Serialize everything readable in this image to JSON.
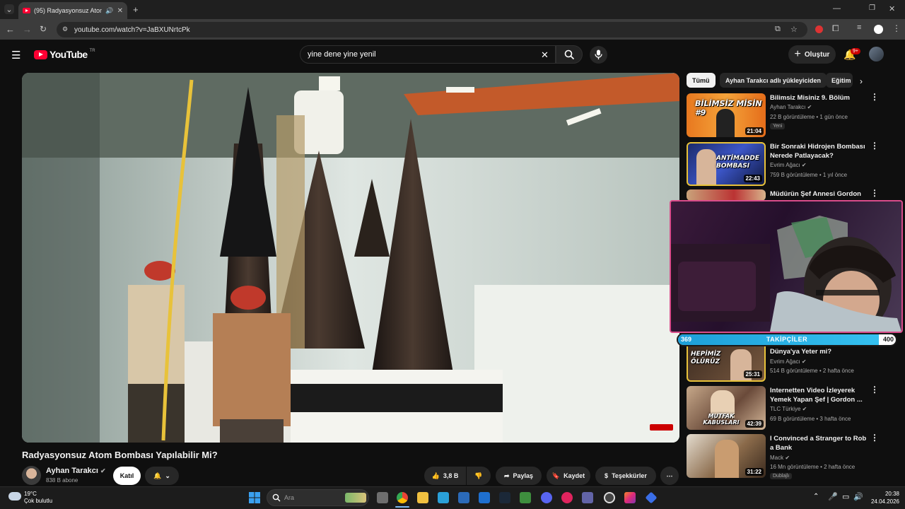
{
  "browser": {
    "tab_title": "(95) Radyasyonsuz Atom Bo",
    "url": "youtube.com/watch?v=JaBXUNrtcPk",
    "new_tab_symbol": "+"
  },
  "youtube": {
    "logo_text": "YouTube",
    "logo_region": "TR",
    "search_value": "yine dene yine yenil",
    "create_label": "Oluştur",
    "notification_count": "9+"
  },
  "video": {
    "title": "Radyasyonsuz Atom Bombası Yapılabilir Mi?",
    "channel": "Ayhan Tarakcı",
    "subscribers": "838 B abone",
    "join_label": "Katıl",
    "likes": "3,8 B",
    "share_label": "Paylaş",
    "save_label": "Kaydet",
    "thanks_label": "Teşekkürler"
  },
  "chips": [
    "Tümü",
    "Ayhan Tarakcı adlı yükleyiciden",
    "Eğitim"
  ],
  "recommendations": [
    {
      "title": "Bilimsiz Misiniz 9. Bölüm",
      "channel": "Ayhan Tarakcı",
      "meta": "22 B görüntüleme • 1 gün önce",
      "duration": "21:04",
      "tag": "Yeni",
      "thumb_text": "BİLİMSİZ MİSİN #9"
    },
    {
      "title": "Bir Sonraki Hidrojen Bombası Nerede Patlayacak?",
      "channel": "Evrim Ağacı",
      "meta": "759 B görüntüleme • 1 yıl önce",
      "duration": "22:43",
      "thumb_text": "ANTİMADDE BOMBASI"
    },
    {
      "title": "Müdürün Şef Annesi Gordon",
      "channel": "",
      "meta": "",
      "duration": ""
    },
    {
      "title": "Dünya'ya Yeter mi?",
      "channel": "Evrim Ağacı",
      "meta": "514 B görüntüleme • 2 hafta önce",
      "duration": "25:31",
      "thumb_text": "HEPİMİZ ÖLÜRÜZ"
    },
    {
      "title": "Internetten Video İzleyerek Yemek Yapan Şef | Gordon ...",
      "channel": "TLC Türkiye",
      "meta": "69 B görüntüleme • 3 hafta önce",
      "duration": "42:39",
      "thumb_text": "MUTFAK KABUSLARI"
    },
    {
      "title": "I Convinced a Stranger to Rob a Bank",
      "channel": "Mack",
      "meta": "16 Mn görüntüleme • 2 hafta önce",
      "duration": "31:22",
      "tag": "Dublajlı"
    }
  ],
  "stream_overlay": {
    "followers_label": "TAKİPÇİLER",
    "current": "369",
    "goal": "400",
    "progress_fraction": 0.9225
  },
  "taskbar": {
    "temperature": "19°C",
    "weather": "Çok bulutlu",
    "search_placeholder": "Ara",
    "time": "20:38",
    "date": "24.04.2026"
  },
  "colors": {
    "youtube_red": "#ff0033",
    "follow_bar": "#35c1f0",
    "cam_border": "#d94c8a"
  }
}
